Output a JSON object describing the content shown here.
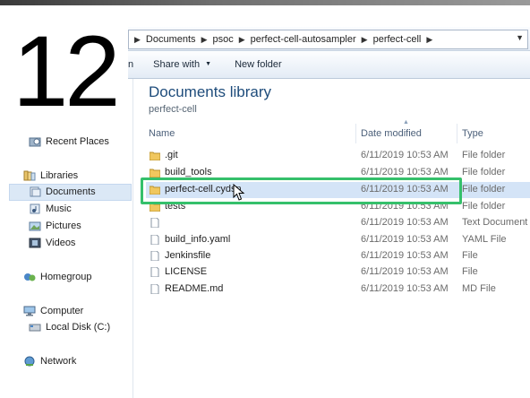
{
  "step_badge": "12",
  "address_bar": {
    "crumbs": [
      "Documents",
      "psoc",
      "perfect-cell-autosampler",
      "perfect-cell"
    ]
  },
  "toolbar": {
    "partial_left": "n",
    "share_with": "Share with",
    "new_folder": "New folder"
  },
  "nav": {
    "recent_places": "Recent Places",
    "libraries": "Libraries",
    "documents": "Documents",
    "music": "Music",
    "pictures": "Pictures",
    "videos": "Videos",
    "homegroup": "Homegroup",
    "computer": "Computer",
    "local_disk": "Local Disk (C:)",
    "network": "Network"
  },
  "library": {
    "title": "Documents library",
    "subtitle": "perfect-cell"
  },
  "columns": {
    "name": "Name",
    "date_modified": "Date modified",
    "type": "Type"
  },
  "files": [
    {
      "name": ".git",
      "date": "6/11/2019 10:53 AM",
      "type": "File folder",
      "icon": "folder-icon"
    },
    {
      "name": "build_tools",
      "date": "6/11/2019 10:53 AM",
      "type": "File folder",
      "icon": "folder-icon"
    },
    {
      "name": "perfect-cell.cydsn",
      "date": "6/11/2019 10:53 AM",
      "type": "File folder",
      "icon": "folder-icon"
    },
    {
      "name": "tests",
      "date": "6/11/2019 10:53 AM",
      "type": "File folder",
      "icon": "folder-icon"
    },
    {
      "name": "",
      "date": "6/11/2019 10:53 AM",
      "type": "Text Document",
      "icon": "document-icon"
    },
    {
      "name": "build_info.yaml",
      "date": "6/11/2019 10:53 AM",
      "type": "YAML File",
      "icon": "document-icon"
    },
    {
      "name": "Jenkinsfile",
      "date": "6/11/2019 10:53 AM",
      "type": "File",
      "icon": "document-icon"
    },
    {
      "name": "LICENSE",
      "date": "6/11/2019 10:53 AM",
      "type": "File",
      "icon": "document-icon"
    },
    {
      "name": "README.md",
      "date": "6/11/2019 10:53 AM",
      "type": "MD File",
      "icon": "document-icon"
    }
  ],
  "colors": {
    "highlight_border": "#35c06b",
    "selection": "#d4e4f7",
    "title_blue": "#1e4c7b"
  }
}
